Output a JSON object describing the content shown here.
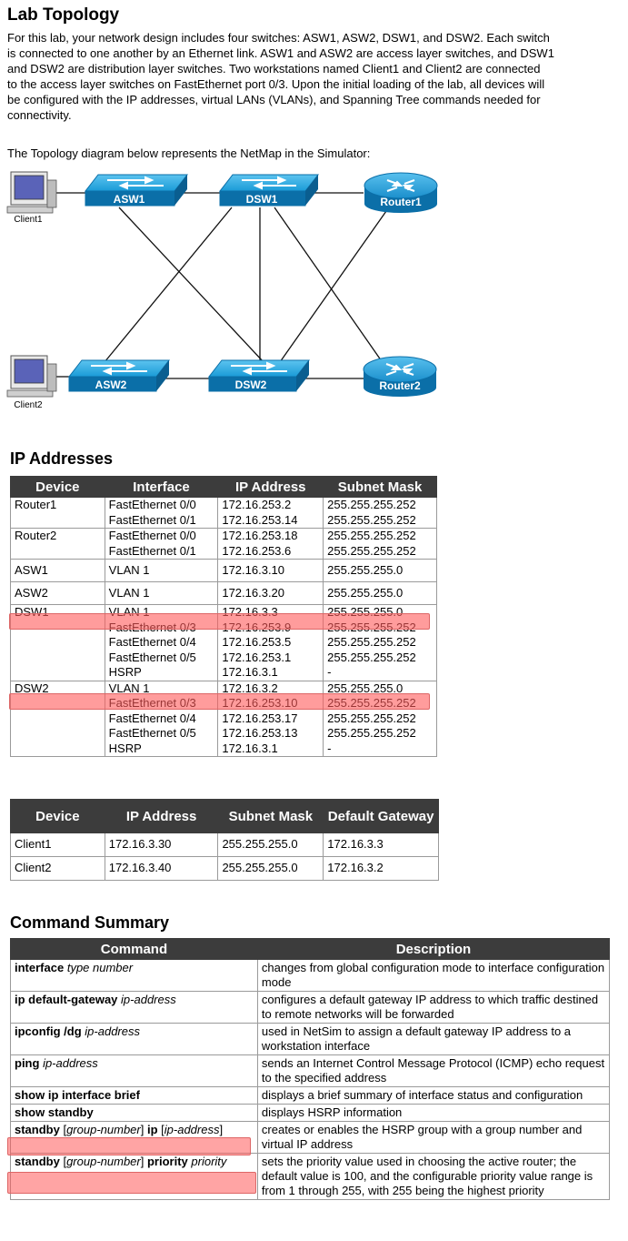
{
  "header": {
    "title": "Lab Topology",
    "intro": [
      "For this lab, your network design includes four switches: ASW1, ASW2, DSW1, and DSW2. Each switch",
      "is connected to one another by an Ethernet link. ASW1 and ASW2 are access layer switches, and DSW1",
      "and DSW2 are distribution layer switches. Two workstations named Client1 and Client2 are connected",
      "to the access layer switches on FastEthernet port 0/3. Upon the initial loading of the lab, all devices will",
      "be configured with the IP addresses, virtual LANs (VLANs), and Spanning Tree commands needed for",
      "connectivity."
    ],
    "caption": "The Topology diagram below represents the NetMap in the Simulator:"
  },
  "topology": {
    "switches": {
      "asw1": "ASW1",
      "dsw1": "DSW1",
      "asw2": "ASW2",
      "dsw2": "DSW2"
    },
    "routers": {
      "router1": "Router1",
      "router2": "Router2"
    },
    "clients": {
      "client1": "Client1",
      "client2": "Client2"
    },
    "colors": {
      "device_blue": "#1a9bd7",
      "device_dark": "#0b6fa8",
      "link": "#111111"
    }
  },
  "ip_section": {
    "title": "IP Addresses",
    "headers": [
      "Device",
      "Interface",
      "IP Address",
      "Subnet Mask"
    ],
    "rows": [
      {
        "device": "Router1",
        "interfaces": [
          "FastEthernet 0/0",
          "FastEthernet 0/1"
        ],
        "ips": [
          "172.16.253.2",
          "172.16.253.14"
        ],
        "masks": [
          "255.255.255.252",
          "255.255.255.252"
        ]
      },
      {
        "device": "Router2",
        "interfaces": [
          "FastEthernet 0/0",
          "FastEthernet 0/1"
        ],
        "ips": [
          "172.16.253.18",
          "172.16.253.6"
        ],
        "masks": [
          "255.255.255.252",
          "255.255.255.252"
        ]
      },
      {
        "device": "ASW1",
        "interfaces": [
          "VLAN 1"
        ],
        "ips": [
          "172.16.3.10"
        ],
        "masks": [
          "255.255.255.0"
        ]
      },
      {
        "device": "ASW2",
        "interfaces": [
          "VLAN 1"
        ],
        "ips": [
          "172.16.3.20"
        ],
        "masks": [
          "255.255.255.0"
        ]
      },
      {
        "device": "DSW1",
        "interfaces": [
          "VLAN 1",
          "FastEthernet 0/3",
          "FastEthernet 0/4",
          "FastEthernet 0/5",
          "HSRP"
        ],
        "ips": [
          "172.16.3.3",
          "172.16.253.9",
          "172.16.253.5",
          "172.16.253.1",
          "172.16.3.1"
        ],
        "masks": [
          "255.255.255.0",
          "255.255.255.252",
          "255.255.255.252",
          "255.255.255.252",
          "-"
        ]
      },
      {
        "device": "DSW2",
        "interfaces": [
          "VLAN 1",
          "FastEthernet 0/3",
          "FastEthernet 0/4",
          "FastEthernet 0/5",
          "HSRP"
        ],
        "ips": [
          "172.16.3.2",
          "172.16.253.10",
          "172.16.253.17",
          "172.16.253.13",
          "172.16.3.1"
        ],
        "masks": [
          "255.255.255.0",
          "255.255.255.252",
          "255.255.255.252",
          "255.255.255.252",
          "-"
        ]
      }
    ]
  },
  "gateway_table": {
    "headers": [
      "Device",
      "IP Address",
      "Subnet Mask",
      "Default Gateway"
    ],
    "rows": [
      [
        "Client1",
        "172.16.3.30",
        "255.255.255.0",
        "172.16.3.3"
      ],
      [
        "Client2",
        "172.16.3.40",
        "255.255.255.0",
        "172.16.3.2"
      ]
    ]
  },
  "command_section": {
    "title": "Command Summary",
    "headers": [
      "Command",
      "Description"
    ],
    "rows": [
      {
        "cmd": [
          [
            "b",
            "interface"
          ],
          [
            "t",
            " "
          ],
          [
            "i",
            "type number"
          ]
        ],
        "desc": "changes from global configuration mode to interface configuration mode"
      },
      {
        "cmd": [
          [
            "b",
            "ip default-gateway"
          ],
          [
            "t",
            " "
          ],
          [
            "i",
            "ip-address"
          ]
        ],
        "desc": "configures a default gateway IP address to which traffic destined to remote networks will be forwarded"
      },
      {
        "cmd": [
          [
            "b",
            "ipconfig /dg"
          ],
          [
            "t",
            " "
          ],
          [
            "i",
            "ip-address"
          ]
        ],
        "desc": "used in NetSim to assign a default gateway IP address to a workstation interface"
      },
      {
        "cmd": [
          [
            "b",
            "ping"
          ],
          [
            "t",
            " "
          ],
          [
            "i",
            "ip-address"
          ]
        ],
        "desc": "sends an Internet Control Message Protocol (ICMP) echo request to the specified address"
      },
      {
        "cmd": [
          [
            "b",
            "show ip interface brief"
          ]
        ],
        "desc": "displays a brief summary of interface status and configuration"
      },
      {
        "cmd": [
          [
            "b",
            "show standby"
          ]
        ],
        "desc": "displays HSRP information"
      },
      {
        "cmd": [
          [
            "b",
            "standby"
          ],
          [
            "t",
            " ["
          ],
          [
            "i",
            "group-number"
          ],
          [
            "t",
            "] "
          ],
          [
            "b",
            "ip"
          ],
          [
            "t",
            " ["
          ],
          [
            "i",
            "ip-address"
          ],
          [
            "t",
            "]"
          ]
        ],
        "desc": "creates or enables the HSRP group with a group number and virtual IP address"
      },
      {
        "cmd": [
          [
            "b",
            "standby"
          ],
          [
            "t",
            " ["
          ],
          [
            "i",
            "group-number"
          ],
          [
            "t",
            "] "
          ],
          [
            "b",
            "priority"
          ],
          [
            "t",
            " "
          ],
          [
            "i",
            "priority"
          ]
        ],
        "desc": "sets the priority value used in choosing the active router; the default value is 100, and the configurable priority value range is from 1 through 255, with 255 being the highest priority"
      }
    ]
  },
  "highlight_color": "#ff5a5a"
}
